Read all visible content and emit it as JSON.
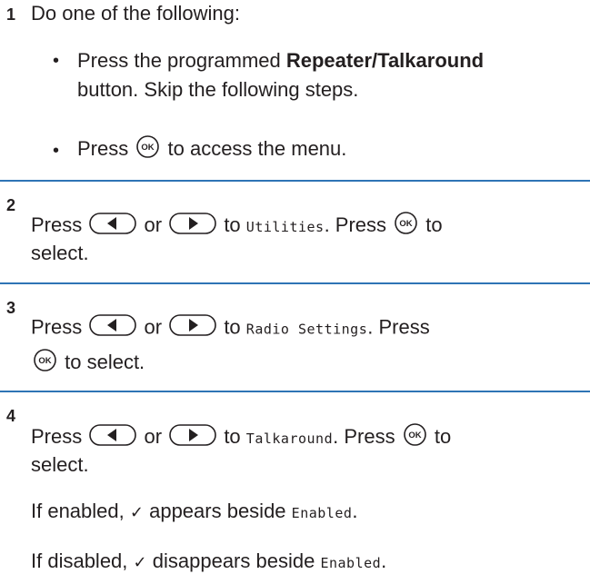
{
  "steps": [
    {
      "number": "1",
      "intro": "Do one of the following:",
      "bullets": [
        {
          "marker": "•",
          "line1_pre": "Press the programmed ",
          "line1_bold": "Repeater/Talkaround",
          "line2": "button. Skip the following steps."
        },
        {
          "marker": "•",
          "pre": "Press",
          "post": "to access the menu."
        }
      ]
    },
    {
      "number": "2",
      "press": "Press",
      "or": "or",
      "to": "to",
      "menu_item": "Utilities",
      "press2": ". Press",
      "to2": "to",
      "select": "select."
    },
    {
      "number": "3",
      "press": "Press",
      "or": "or",
      "to": "to",
      "menu_item": "Radio Settings",
      "press2": ". Press",
      "to_select": "to select."
    },
    {
      "number": "4",
      "press": "Press",
      "or": "or",
      "to": "to",
      "menu_item": "Talkaround",
      "press2": ". Press",
      "to2": "to",
      "select": "select.",
      "enabled_pre": "If enabled,",
      "check": "✓",
      "enabled_mid": "appears beside",
      "enabled_item": "Enabled",
      "enabled_end": ".",
      "disabled_pre": "If disabled,",
      "disabled_mid": "disappears beside",
      "disabled_item": "Enabled",
      "disabled_end": "."
    }
  ],
  "icons": {
    "ok": "OK",
    "left_arrow": "left-arrow-button-icon",
    "right_arrow": "right-arrow-button-icon"
  },
  "colors": {
    "separator": "#2e74b5",
    "text": "#231f20"
  }
}
